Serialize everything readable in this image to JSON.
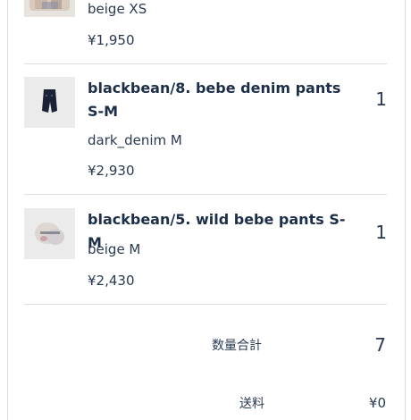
{
  "cart": {
    "items": [
      {
        "title": "",
        "variant": "beige XS",
        "price": "¥1,950",
        "quantity": ""
      },
      {
        "title": "blackbean/8. bebe denim pants S-M",
        "variant": "dark_denim M",
        "price": "¥2,930",
        "quantity": "1"
      },
      {
        "title": "blackbean/5. wild bebe pants S-M",
        "variant": "beige M",
        "price": "¥2,430",
        "quantity": "1"
      }
    ]
  },
  "summary": {
    "quantity_total_label": "数量合計",
    "quantity_total_value": "7",
    "shipping_label": "送料",
    "shipping_value": "¥0"
  },
  "colors": {
    "text": "#1f2f45",
    "divider": "#dedede"
  }
}
